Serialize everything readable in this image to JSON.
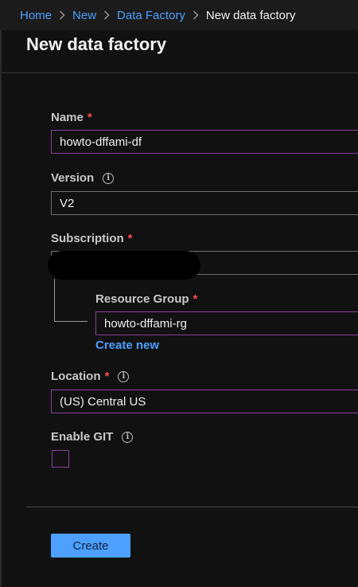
{
  "breadcrumb": {
    "items": [
      "Home",
      "New",
      "Data Factory"
    ],
    "current": "New data factory"
  },
  "page": {
    "title": "New data factory"
  },
  "form": {
    "name": {
      "label": "Name",
      "required_mark": "*",
      "value": "howto-dffami-df"
    },
    "version": {
      "label": "Version",
      "value": "V2",
      "info_icon": "info-icon"
    },
    "subscription": {
      "label": "Subscription",
      "required_mark": "*",
      "value": ""
    },
    "resource_group": {
      "label": "Resource Group",
      "required_mark": "*",
      "value": "howto-dffami-rg",
      "create_new_link": "Create new"
    },
    "location": {
      "label": "Location",
      "required_mark": "*",
      "value": "(US) Central US",
      "info_icon": "info-icon"
    },
    "enable_git": {
      "label": "Enable GIT",
      "checked": false,
      "info_icon": "info-icon"
    }
  },
  "actions": {
    "create_label": "Create"
  },
  "colors": {
    "accent": "#4ea0ff",
    "required": "#ff4d4f",
    "focus_border": "#8a3f9a",
    "background": "#111111"
  }
}
